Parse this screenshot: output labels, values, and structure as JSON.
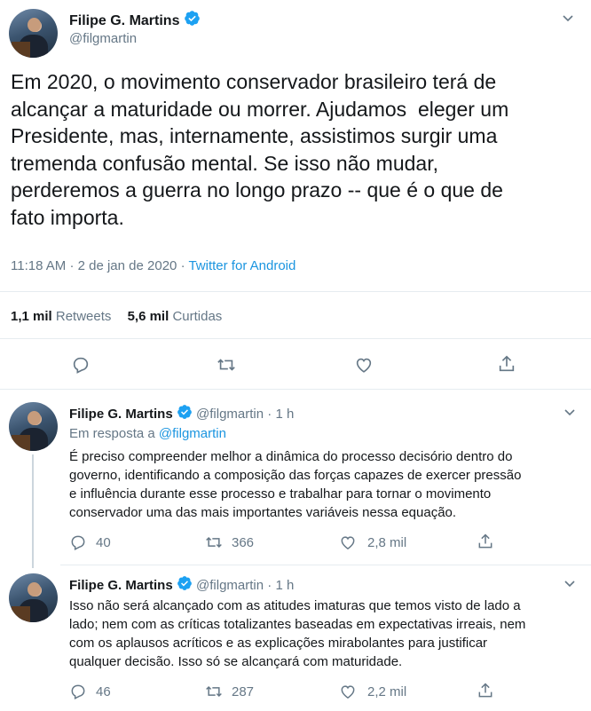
{
  "main_tweet": {
    "author_name": "Filipe G. Martins",
    "handle": "@filgmartin",
    "text_lines": [
      "Em 2020, o movimento conservador brasileiro terá de",
      "alcançar a maturidade ou morrer. Ajudamos  eleger um",
      "Presidente, mas, internamente, assistimos surgir uma",
      "tremenda confusão mental. Se isso não mudar,",
      "perderemos a guerra no longo prazo -- que é o que de",
      "fato importa."
    ],
    "time": "11:18 AM",
    "date": "2 de jan de 2020",
    "separator": "·",
    "source": "Twitter for Android",
    "retweets_count": "1,1 mil",
    "retweets_label": "Retweets",
    "likes_count": "5,6 mil",
    "likes_label": "Curtidas"
  },
  "replies": [
    {
      "author_name": "Filipe G. Martins",
      "handle": "@filgmartin",
      "separator": "·",
      "time_ago": "1 h",
      "reply_to_prefix": "Em resposta a",
      "reply_to_handle": "@filgmartin",
      "text_lines": [
        "É preciso compreender melhor a dinâmica do processo decisório dentro do",
        "governo, identificando a composição das forças capazes de exercer pressão",
        "e influência durante esse processo e trabalhar para tornar o movimento",
        "conservador uma das mais importantes variáveis nessa equação."
      ],
      "reply_count": "40",
      "retweet_count": "366",
      "like_count": "2,8 mil"
    },
    {
      "author_name": "Filipe G. Martins",
      "handle": "@filgmartin",
      "separator": "·",
      "time_ago": "1 h",
      "text_lines": [
        "Isso não será alcançado com as atitudes imaturas que temos visto de lado a",
        "lado; nem com as críticas totalizantes baseadas em expectativas irreais, nem",
        "com os aplausos acríticos e as explicações mirabolantes para justificar",
        "qualquer decisão. Isso só se alcançará com maturidade."
      ],
      "reply_count": "46",
      "retweet_count": "287",
      "like_count": "2,2 mil"
    }
  ],
  "icons": {
    "verified": "verified-badge-icon",
    "chevron": "chevron-down-icon",
    "reply": "reply-icon",
    "retweet": "retweet-icon",
    "like": "heart-icon",
    "share": "share-icon"
  },
  "colors": {
    "link": "#1b95e0",
    "verified": "#1da1f2",
    "muted": "#657786",
    "divider": "#e6ecf0",
    "thread_line": "#ccd6dd"
  }
}
